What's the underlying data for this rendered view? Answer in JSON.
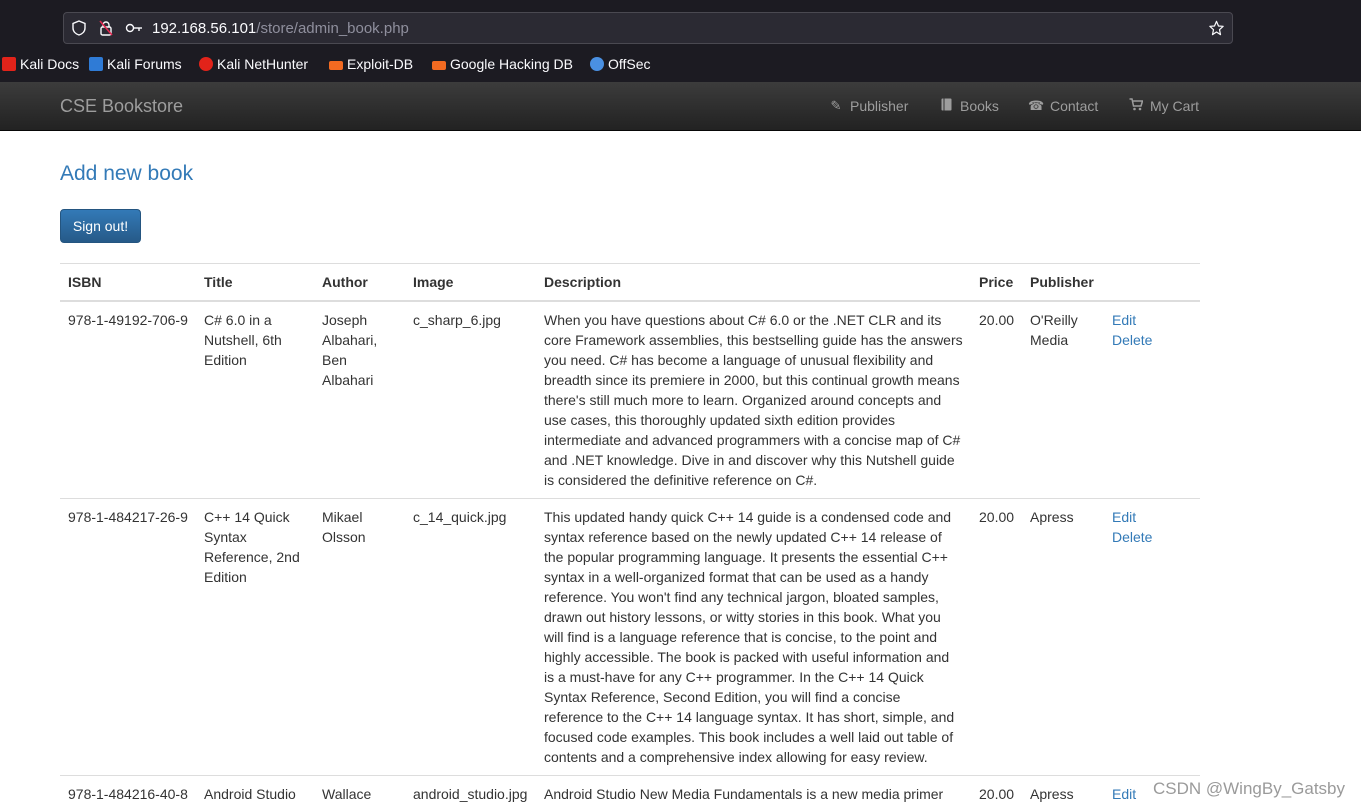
{
  "browser": {
    "url_host": "192.168.56.101",
    "url_path": "/store/admin_book.php",
    "bookmarks": [
      {
        "label": "Kali Docs",
        "icon": "kali-docs-icon",
        "color": "#e2231a"
      },
      {
        "label": "Kali Forums",
        "icon": "kali-forums-icon",
        "color": "#2f7bd6"
      },
      {
        "label": "Kali NetHunter",
        "icon": "kali-nethunter-icon",
        "color": "#e2231a"
      },
      {
        "label": "Exploit-DB",
        "icon": "exploit-db-icon",
        "color": "#f26a21"
      },
      {
        "label": "Google Hacking DB",
        "icon": "ghdb-icon",
        "color": "#f26a21"
      },
      {
        "label": "OffSec",
        "icon": "offsec-icon",
        "color": "#4a90e2"
      }
    ]
  },
  "navbar": {
    "brand": "CSE Bookstore",
    "items": [
      {
        "label": "Publisher",
        "icon": "pencil-icon"
      },
      {
        "label": "Books",
        "icon": "book-icon"
      },
      {
        "label": "Contact",
        "icon": "phone-icon"
      },
      {
        "label": "My Cart",
        "icon": "cart-icon"
      }
    ]
  },
  "main": {
    "heading": "Add new book",
    "signout_label": "Sign out!"
  },
  "table": {
    "headers": [
      "ISBN",
      "Title",
      "Author",
      "Image",
      "Description",
      "Price",
      "Publisher",
      ""
    ],
    "edit_label": "Edit",
    "delete_label": "Delete",
    "rows": [
      {
        "isbn": "978-1-49192-706-9",
        "title": "C# 6.0 in a Nutshell, 6th Edition",
        "author": "Joseph Albahari, Ben Albahari",
        "image": "c_sharp_6.jpg",
        "description": "When you have questions about C# 6.0 or the .NET CLR and its core Framework assemblies, this bestselling guide has the answers you need. C# has become a language of unusual flexibility and breadth since its premiere in 2000, but this continual growth means there's still much more to learn. Organized around concepts and use cases, this thoroughly updated sixth edition provides intermediate and advanced programmers with a concise map of C# and .NET knowledge. Dive in and discover why this Nutshell guide is considered the definitive reference on C#.",
        "price": "20.00",
        "publisher": "O'Reilly Media"
      },
      {
        "isbn": "978-1-484217-26-9",
        "title": "C++ 14 Quick Syntax Reference, 2nd Edition",
        "author": "Mikael Olsson",
        "image": "c_14_quick.jpg",
        "description": "This updated handy quick C++ 14 guide is a condensed code and syntax reference based on the newly updated C++ 14 release of the popular programming language. It presents the essential C++ syntax in a well-organized format that can be used as a handy reference. You won't find any technical jargon, bloated samples, drawn out history lessons, or witty stories in this book. What you will find is a language reference that is concise, to the point and highly accessible. The book is packed with useful information and is a must-have for any C++ programmer. In the C++ 14 Quick Syntax Reference, Second Edition, you will find a concise reference to the C++ 14 language syntax. It has short, simple, and focused code examples. This book includes a well laid out table of contents and a comprehensive index allowing for easy review.",
        "price": "20.00",
        "publisher": "Apress"
      },
      {
        "isbn": "978-1-484216-40-8",
        "title": "Android Studio",
        "author": "Wallace",
        "image": "android_studio.jpg",
        "description": "Android Studio New Media Fundamentals is a new media primer",
        "price": "20.00",
        "publisher": "Apress"
      }
    ]
  },
  "watermark": "CSDN @WingBy_Gatsby"
}
